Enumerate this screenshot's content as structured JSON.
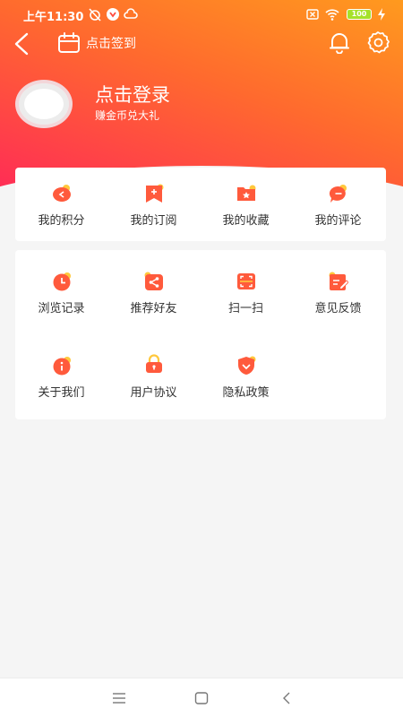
{
  "status_bar": {
    "time": "上午11:30",
    "battery": "100"
  },
  "nav": {
    "checkin_label": "点击签到"
  },
  "profile": {
    "title": "点击登录",
    "subtitle": "赚金币兑大礼"
  },
  "quick_menu": [
    {
      "label": "我的积分",
      "icon": "points-icon"
    },
    {
      "label": "我的订阅",
      "icon": "subscribe-icon"
    },
    {
      "label": "我的收藏",
      "icon": "favorite-folder-icon"
    },
    {
      "label": "我的评论",
      "icon": "comment-icon"
    }
  ],
  "tools_menu": [
    {
      "label": "浏览记录",
      "icon": "clock-icon"
    },
    {
      "label": "推荐好友",
      "icon": "share-icon"
    },
    {
      "label": "扫一扫",
      "icon": "scan-icon"
    },
    {
      "label": "意见反馈",
      "icon": "feedback-icon"
    },
    {
      "label": "关于我们",
      "icon": "info-icon"
    },
    {
      "label": "用户协议",
      "icon": "lock-icon"
    },
    {
      "label": "隐私政策",
      "icon": "shield-icon"
    }
  ],
  "colors": {
    "gradient_start": "#ff9a1e",
    "gradient_end": "#ff2d55",
    "icon_main": "#ff5a3c",
    "icon_accent": "#ffc83c"
  }
}
